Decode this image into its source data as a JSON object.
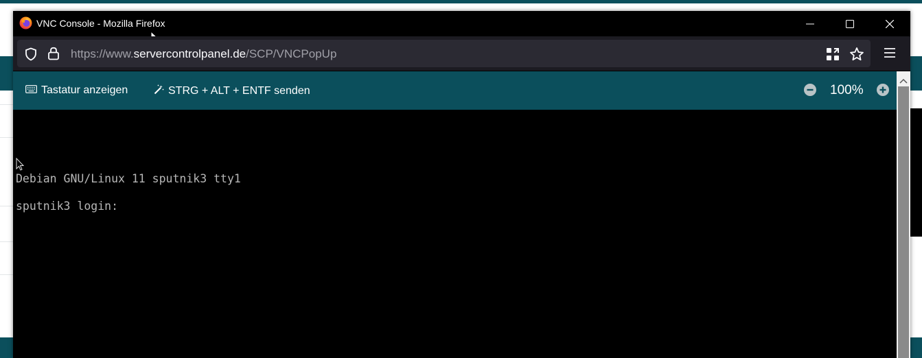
{
  "window": {
    "title": "VNC Console - Mozilla Firefox",
    "controls": [
      "minimize",
      "maximize",
      "close"
    ]
  },
  "address_bar": {
    "prefix": "https://www.",
    "host": "servercontrolpanel.de",
    "path": "/SCP/VNCPopUp",
    "icons": [
      "shield-icon",
      "lock-icon",
      "qr-code-icon",
      "bookmark-star-icon",
      "hamburger-menu-icon"
    ]
  },
  "toolbar": {
    "keyboard_label": "Tastatur anzeigen",
    "ctrl_alt_del_label": "STRG + ALT + ENTF senden",
    "zoom_level": "100%"
  },
  "console": {
    "lines": [
      "Debian GNU/Linux 11 sputnik3 tty1",
      "sputnik3 login:"
    ]
  },
  "colors": {
    "accent": "#0b4f5c",
    "titlebar": "#000000",
    "urlbar": "#2b2a33",
    "console_text": "#b7b7b7"
  }
}
